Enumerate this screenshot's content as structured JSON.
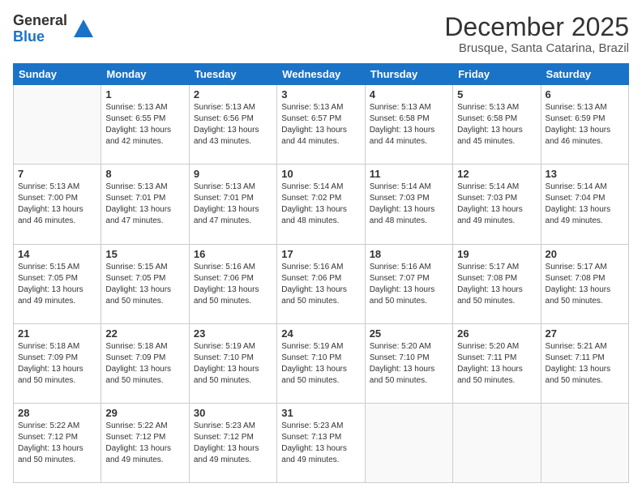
{
  "logo": {
    "general": "General",
    "blue": "Blue"
  },
  "title": "December 2025",
  "subtitle": "Brusque, Santa Catarina, Brazil",
  "days_header": [
    "Sunday",
    "Monday",
    "Tuesday",
    "Wednesday",
    "Thursday",
    "Friday",
    "Saturday"
  ],
  "weeks": [
    [
      {
        "day": "",
        "content": ""
      },
      {
        "day": "1",
        "content": "Sunrise: 5:13 AM\nSunset: 6:55 PM\nDaylight: 13 hours\nand 42 minutes."
      },
      {
        "day": "2",
        "content": "Sunrise: 5:13 AM\nSunset: 6:56 PM\nDaylight: 13 hours\nand 43 minutes."
      },
      {
        "day": "3",
        "content": "Sunrise: 5:13 AM\nSunset: 6:57 PM\nDaylight: 13 hours\nand 44 minutes."
      },
      {
        "day": "4",
        "content": "Sunrise: 5:13 AM\nSunset: 6:58 PM\nDaylight: 13 hours\nand 44 minutes."
      },
      {
        "day": "5",
        "content": "Sunrise: 5:13 AM\nSunset: 6:58 PM\nDaylight: 13 hours\nand 45 minutes."
      },
      {
        "day": "6",
        "content": "Sunrise: 5:13 AM\nSunset: 6:59 PM\nDaylight: 13 hours\nand 46 minutes."
      }
    ],
    [
      {
        "day": "7",
        "content": "Sunrise: 5:13 AM\nSunset: 7:00 PM\nDaylight: 13 hours\nand 46 minutes."
      },
      {
        "day": "8",
        "content": "Sunrise: 5:13 AM\nSunset: 7:01 PM\nDaylight: 13 hours\nand 47 minutes."
      },
      {
        "day": "9",
        "content": "Sunrise: 5:13 AM\nSunset: 7:01 PM\nDaylight: 13 hours\nand 47 minutes."
      },
      {
        "day": "10",
        "content": "Sunrise: 5:14 AM\nSunset: 7:02 PM\nDaylight: 13 hours\nand 48 minutes."
      },
      {
        "day": "11",
        "content": "Sunrise: 5:14 AM\nSunset: 7:03 PM\nDaylight: 13 hours\nand 48 minutes."
      },
      {
        "day": "12",
        "content": "Sunrise: 5:14 AM\nSunset: 7:03 PM\nDaylight: 13 hours\nand 49 minutes."
      },
      {
        "day": "13",
        "content": "Sunrise: 5:14 AM\nSunset: 7:04 PM\nDaylight: 13 hours\nand 49 minutes."
      }
    ],
    [
      {
        "day": "14",
        "content": "Sunrise: 5:15 AM\nSunset: 7:05 PM\nDaylight: 13 hours\nand 49 minutes."
      },
      {
        "day": "15",
        "content": "Sunrise: 5:15 AM\nSunset: 7:05 PM\nDaylight: 13 hours\nand 50 minutes."
      },
      {
        "day": "16",
        "content": "Sunrise: 5:16 AM\nSunset: 7:06 PM\nDaylight: 13 hours\nand 50 minutes."
      },
      {
        "day": "17",
        "content": "Sunrise: 5:16 AM\nSunset: 7:06 PM\nDaylight: 13 hours\nand 50 minutes."
      },
      {
        "day": "18",
        "content": "Sunrise: 5:16 AM\nSunset: 7:07 PM\nDaylight: 13 hours\nand 50 minutes."
      },
      {
        "day": "19",
        "content": "Sunrise: 5:17 AM\nSunset: 7:08 PM\nDaylight: 13 hours\nand 50 minutes."
      },
      {
        "day": "20",
        "content": "Sunrise: 5:17 AM\nSunset: 7:08 PM\nDaylight: 13 hours\nand 50 minutes."
      }
    ],
    [
      {
        "day": "21",
        "content": "Sunrise: 5:18 AM\nSunset: 7:09 PM\nDaylight: 13 hours\nand 50 minutes."
      },
      {
        "day": "22",
        "content": "Sunrise: 5:18 AM\nSunset: 7:09 PM\nDaylight: 13 hours\nand 50 minutes."
      },
      {
        "day": "23",
        "content": "Sunrise: 5:19 AM\nSunset: 7:10 PM\nDaylight: 13 hours\nand 50 minutes."
      },
      {
        "day": "24",
        "content": "Sunrise: 5:19 AM\nSunset: 7:10 PM\nDaylight: 13 hours\nand 50 minutes."
      },
      {
        "day": "25",
        "content": "Sunrise: 5:20 AM\nSunset: 7:10 PM\nDaylight: 13 hours\nand 50 minutes."
      },
      {
        "day": "26",
        "content": "Sunrise: 5:20 AM\nSunset: 7:11 PM\nDaylight: 13 hours\nand 50 minutes."
      },
      {
        "day": "27",
        "content": "Sunrise: 5:21 AM\nSunset: 7:11 PM\nDaylight: 13 hours\nand 50 minutes."
      }
    ],
    [
      {
        "day": "28",
        "content": "Sunrise: 5:22 AM\nSunset: 7:12 PM\nDaylight: 13 hours\nand 50 minutes."
      },
      {
        "day": "29",
        "content": "Sunrise: 5:22 AM\nSunset: 7:12 PM\nDaylight: 13 hours\nand 49 minutes."
      },
      {
        "day": "30",
        "content": "Sunrise: 5:23 AM\nSunset: 7:12 PM\nDaylight: 13 hours\nand 49 minutes."
      },
      {
        "day": "31",
        "content": "Sunrise: 5:23 AM\nSunset: 7:13 PM\nDaylight: 13 hours\nand 49 minutes."
      },
      {
        "day": "",
        "content": ""
      },
      {
        "day": "",
        "content": ""
      },
      {
        "day": "",
        "content": ""
      }
    ]
  ]
}
